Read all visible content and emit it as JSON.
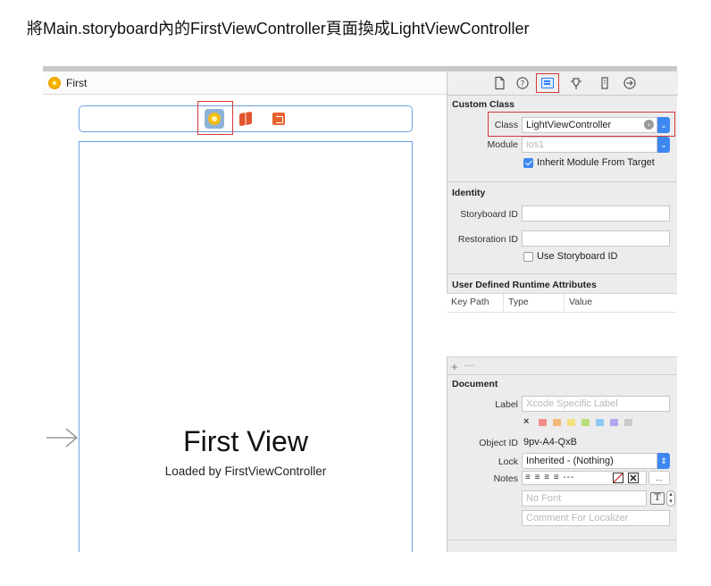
{
  "caption": "將Main.storyboard內的FirstViewController頁面換成LightViewController",
  "canvas": {
    "breadcrumb": "First",
    "view_title": "First View",
    "view_subtitle": "Loaded by FirstViewController",
    "dock_icons": [
      "view-controller-icon",
      "first-responder-icon",
      "exit-icon"
    ]
  },
  "inspector": {
    "tabs": [
      "file-icon",
      "help-icon",
      "identity-icon",
      "attributes-icon",
      "size-icon",
      "connections-icon"
    ],
    "custom_class": {
      "title": "Custom Class",
      "class_label": "Class",
      "class_value": "LightViewController",
      "module_label": "Module",
      "module_placeholder": "ios1",
      "inherit_label": "Inherit Module From Target",
      "inherit_checked": true
    },
    "identity": {
      "title": "Identity",
      "storyboard_id_label": "Storyboard ID",
      "storyboard_id_value": "",
      "restoration_id_label": "Restoration ID",
      "restoration_id_value": "",
      "use_storyboard_label": "Use Storyboard ID",
      "use_storyboard_checked": false
    },
    "runtime_attrs": {
      "title": "User Defined Runtime Attributes",
      "columns": [
        "Key Path",
        "Type",
        "Value"
      ],
      "add": "+",
      "remove": "—"
    },
    "document": {
      "title": "Document",
      "label_label": "Label",
      "label_placeholder": "Xcode Specific Label",
      "color_x": "×",
      "colors": [
        "#f28b8b",
        "#f5b77a",
        "#f3e07a",
        "#b8e07a",
        "#8ec7f2",
        "#b6a6ef",
        "#c9c9c9"
      ],
      "object_id_label": "Object ID",
      "object_id_value": "9pv-A4-QxB",
      "lock_label": "Lock",
      "lock_value": "Inherited - (Nothing)",
      "notes_label": "Notes",
      "notes_toolbar": "≡ ≡ ≡ ≡ ---",
      "notes_more": "...",
      "font_placeholder": "No Font",
      "font_button": "T",
      "comment_placeholder": "Comment For Localizer"
    }
  },
  "colors": {
    "accent": "#3d87f0",
    "highlight": "#d23a3a",
    "scene_border": "#6d9fe0"
  }
}
